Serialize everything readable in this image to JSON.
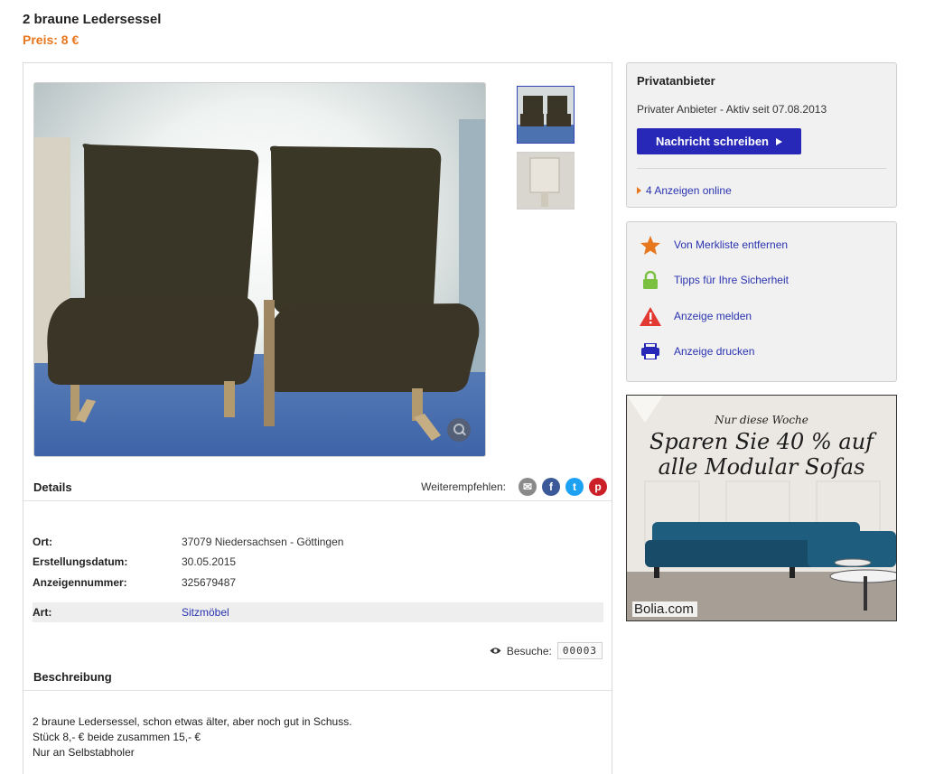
{
  "listing": {
    "title": "2 braune Ledersessel",
    "price": "Preis: 8 €"
  },
  "details": {
    "heading": "Details",
    "share_label": "Weiterempfehlen:",
    "share_icons": [
      "email-icon",
      "facebook-icon",
      "twitter-icon",
      "pinterest-icon"
    ],
    "rows": [
      {
        "label": "Ort:",
        "value": "37079 Niedersachsen - Göttingen"
      },
      {
        "label": "Erstellungsdatum:",
        "value": "30.05.2015"
      },
      {
        "label": "Anzeigennummer:",
        "value": "325679487"
      },
      {
        "label": "Art:",
        "value": "Sitzmöbel"
      }
    ],
    "visits_label": "Besuche:",
    "visits_count": "00003"
  },
  "description": {
    "heading": "Beschreibung",
    "lines": [
      "2 braune Ledersessel, schon etwas älter, aber noch gut in Schuss.",
      "Stück 8,- € beide zusammen 15,- €",
      "Nur an Selbstabholer"
    ]
  },
  "seller": {
    "heading": "Privatanbieter",
    "status": "Privater Anbieter - Aktiv seit 07.08.2013",
    "message_button": "Nachricht schreiben",
    "ads_online": "4 Anzeigen online"
  },
  "actions": [
    {
      "label": "Von Merkliste entfernen",
      "icon": "star-icon"
    },
    {
      "label": "Tipps für Ihre Sicherheit",
      "icon": "lock-icon"
    },
    {
      "label": "Anzeige melden",
      "icon": "warning-icon"
    },
    {
      "label": "Anzeige drucken",
      "icon": "printer-icon"
    }
  ],
  "banner": {
    "subline": "Nur diese Woche",
    "headline_1": "Sparen Sie 40 % auf",
    "headline_2": "alle Modular Sofas",
    "brand": "Bolia.com"
  },
  "colors": {
    "accent_orange": "#e8761d",
    "link_blue": "#2a33b0",
    "button_blue": "#2727b8"
  }
}
